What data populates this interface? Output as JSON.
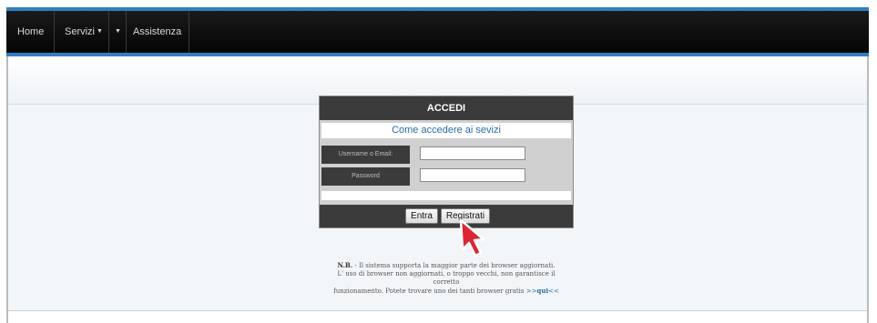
{
  "nav": {
    "home": "Home",
    "servizi": "Servizi",
    "assistenza": "Assistenza"
  },
  "login": {
    "title": "ACCEDI",
    "help_link": "Come accedere ai sevizi",
    "username_label": "Username o Email:",
    "username_value": "",
    "password_label": "Password",
    "password_value": "",
    "login_button": "Entra",
    "register_button": "Registrati"
  },
  "note": {
    "prefix": "N.B.",
    "line1": " - Il sistema supporta la maggior parte dei browser aggiornati.",
    "line2": "L' uso di browser non aggiornati, o troppo vecchi, non garantisce il",
    "line3": "corretto",
    "line4": "funzionamento. Potete trovare uno dei tanti browser gratis ",
    "link_prefix": ">>",
    "link_text": "qui",
    "link_suffix": "<<"
  },
  "colors": {
    "navbar_bg": "#0a0a0a",
    "accent_blue": "#2d7fc6",
    "login_dark": "#3b3b3b",
    "login_gray": "#d0d0d0",
    "link_blue": "#2a6bb0",
    "cursor_red": "#e0242f"
  },
  "icons": {
    "dropdown": "chevron-down-icon",
    "cursor": "mouse-pointer-icon"
  }
}
